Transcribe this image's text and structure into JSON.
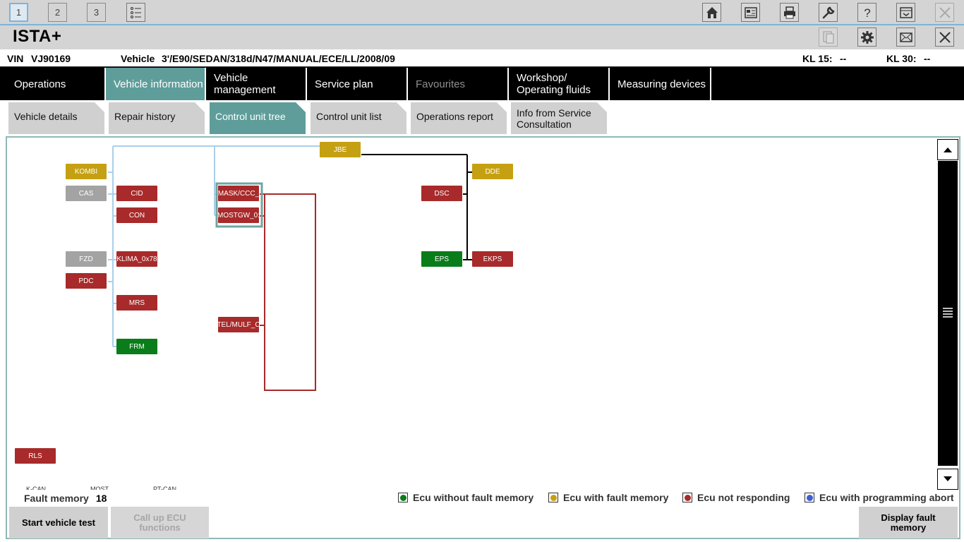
{
  "toolbar": {
    "workspaces": [
      "1",
      "2",
      "3"
    ],
    "icons": [
      "list-icon",
      "home-icon",
      "vehicle-id-icon",
      "print-icon",
      "wrench-icon",
      "help-icon",
      "minimize-icon",
      "close-icon"
    ]
  },
  "app": {
    "title": "ISTA+"
  },
  "vehicle": {
    "vin_label": "VIN",
    "vin": "VJ90169",
    "vehicle_label": "Vehicle",
    "vehicle": "3'/E90/SEDAN/318d/N47/MANUAL/ECE/LL/2008/09",
    "kl15_label": "KL 15:",
    "kl15": "--",
    "kl30_label": "KL 30:",
    "kl30": "--"
  },
  "mainnav": [
    {
      "label": "Operations"
    },
    {
      "label": "Vehicle information",
      "active": true
    },
    {
      "label": "Vehicle\nmanagement"
    },
    {
      "label": "Service plan"
    },
    {
      "label": "Favourites",
      "disabled": true
    },
    {
      "label": "Workshop/\nOperating fluids"
    },
    {
      "label": "Measuring devices"
    }
  ],
  "subtabs": [
    {
      "label": "Vehicle details"
    },
    {
      "label": "Repair history"
    },
    {
      "label": "Control unit tree",
      "active": true
    },
    {
      "label": "Control unit list"
    },
    {
      "label": "Operations report"
    },
    {
      "label": "Info from Service\nConsultation"
    }
  ],
  "ecus": [
    {
      "id": "JBE",
      "status": "yellow"
    },
    {
      "id": "KOMBI",
      "status": "yellow"
    },
    {
      "id": "CAS",
      "status": "grey"
    },
    {
      "id": "CID",
      "status": "red"
    },
    {
      "id": "CON",
      "status": "red"
    },
    {
      "id": "MASK/CCC_",
      "status": "red"
    },
    {
      "id": "MOSTGW_0:",
      "status": "red"
    },
    {
      "id": "FZD",
      "status": "grey"
    },
    {
      "id": "KLIMA_0x78",
      "status": "red"
    },
    {
      "id": "PDC",
      "status": "red"
    },
    {
      "id": "MRS",
      "status": "red"
    },
    {
      "id": "TEL/MULF_C",
      "status": "red"
    },
    {
      "id": "FRM",
      "status": "green"
    },
    {
      "id": "DDE",
      "status": "yellow"
    },
    {
      "id": "DSC",
      "status": "red"
    },
    {
      "id": "EPS",
      "status": "green"
    },
    {
      "id": "EKPS",
      "status": "red"
    },
    {
      "id": "RLS",
      "status": "red"
    }
  ],
  "bus_legend": {
    "kcan": "K-CAN",
    "most": "MOST",
    "ptcan": "PT-CAN"
  },
  "fault_memory": {
    "label": "Fault memory",
    "count": "18"
  },
  "status_legend": [
    {
      "label": "Ecu without fault memory",
      "color": "#0a7d1a"
    },
    {
      "label": "Ecu with fault memory",
      "color": "#c5a012"
    },
    {
      "label": "Ecu not responding",
      "color": "#a82a2a"
    },
    {
      "label": "Ecu with programming abort",
      "color": "#3b5fd1"
    }
  ],
  "buttons": {
    "start_test": "Start vehicle test",
    "call_ecu": "Call up ECU\nfunctions",
    "display_fault": "Display fault\nmemory"
  },
  "colors": {
    "kcan": "#a9d0ea",
    "most": "#a82a2a",
    "ptcan": "#000000",
    "accent": "#5e9d9a"
  }
}
